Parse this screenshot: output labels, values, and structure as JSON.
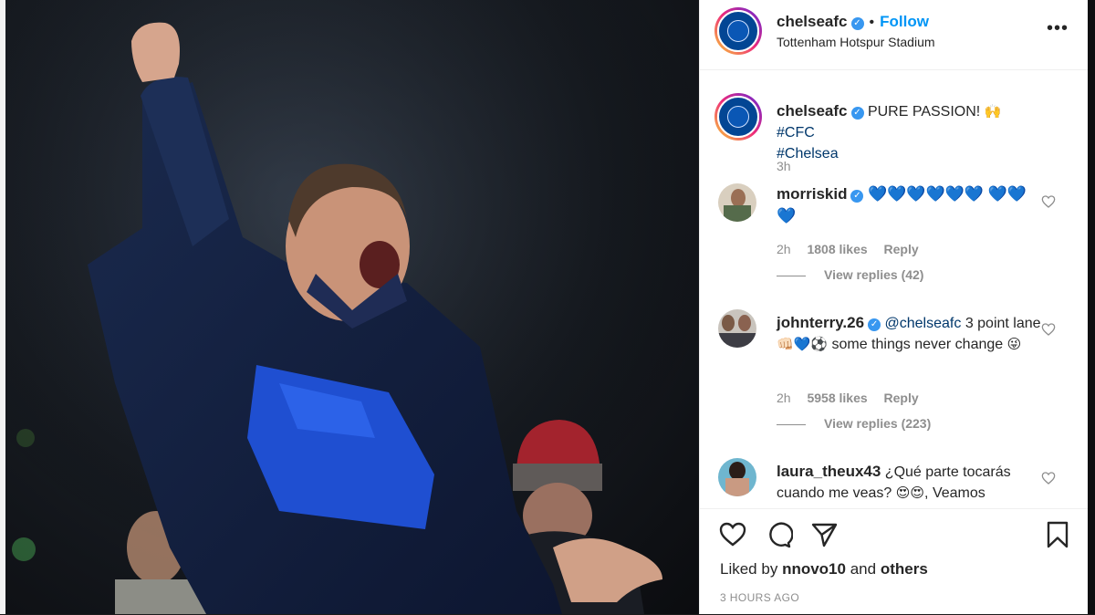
{
  "post": {
    "username": "chelseafc",
    "follow_label": "Follow",
    "location": "Tottenham Hotspur Stadium",
    "more_label": "•••"
  },
  "caption": {
    "username": "chelseafc",
    "text": "PURE PASSION!",
    "emoji": "🙌",
    "hashtags": [
      "#CFC",
      "#Chelsea"
    ],
    "time": "3h"
  },
  "comments": [
    {
      "username": "morriskid",
      "text": "💙💙💙💙💙💙 💙💙💙",
      "time": "2h",
      "likes": "1808 likes",
      "reply_label": "Reply",
      "view_replies": "View replies (42)"
    },
    {
      "username": "johnterry.26",
      "mention": "@chelseafc",
      "text_a": "3 point lane",
      "emoji_a": "👊🏻💙⚽",
      "text_b": "some things never change",
      "emoji_b": "😜",
      "time": "2h",
      "likes": "5958 likes",
      "reply_label": "Reply",
      "view_replies": "View replies (223)"
    },
    {
      "username": "laura_theux43",
      "text_a": "¿Qué parte tocarás cuando me veas?",
      "emoji_a": "😍😍",
      "text_b": ", Veamos"
    }
  ],
  "footer": {
    "liked_by_prefix": "Liked by",
    "liked_by_user": "nnovo10",
    "liked_by_and": "and",
    "liked_by_others": "others",
    "time_ago": "3 HOURS AGO"
  },
  "colors": {
    "accent": "#0095f6",
    "chelsea_blue": "#034694",
    "hashtag": "#00376b",
    "muted": "#8e8e8e"
  }
}
